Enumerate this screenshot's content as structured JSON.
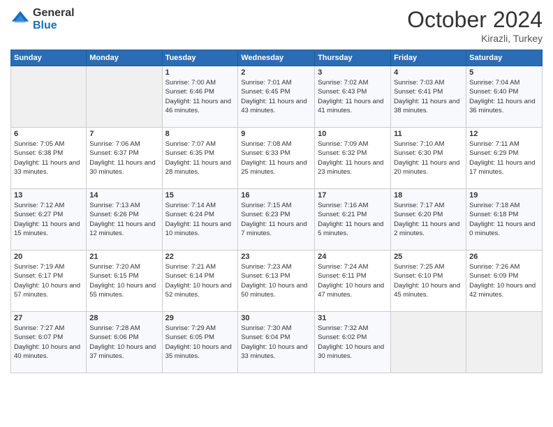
{
  "logo": {
    "general": "General",
    "blue": "Blue"
  },
  "header": {
    "month": "October 2024",
    "location": "Kirazli, Turkey"
  },
  "days_of_week": [
    "Sunday",
    "Monday",
    "Tuesday",
    "Wednesday",
    "Thursday",
    "Friday",
    "Saturday"
  ],
  "weeks": [
    [
      {
        "day": "",
        "sunrise": "",
        "sunset": "",
        "daylight": ""
      },
      {
        "day": "",
        "sunrise": "",
        "sunset": "",
        "daylight": ""
      },
      {
        "day": "1",
        "sunrise": "Sunrise: 7:00 AM",
        "sunset": "Sunset: 6:46 PM",
        "daylight": "Daylight: 11 hours and 46 minutes."
      },
      {
        "day": "2",
        "sunrise": "Sunrise: 7:01 AM",
        "sunset": "Sunset: 6:45 PM",
        "daylight": "Daylight: 11 hours and 43 minutes."
      },
      {
        "day": "3",
        "sunrise": "Sunrise: 7:02 AM",
        "sunset": "Sunset: 6:43 PM",
        "daylight": "Daylight: 11 hours and 41 minutes."
      },
      {
        "day": "4",
        "sunrise": "Sunrise: 7:03 AM",
        "sunset": "Sunset: 6:41 PM",
        "daylight": "Daylight: 11 hours and 38 minutes."
      },
      {
        "day": "5",
        "sunrise": "Sunrise: 7:04 AM",
        "sunset": "Sunset: 6:40 PM",
        "daylight": "Daylight: 11 hours and 36 minutes."
      }
    ],
    [
      {
        "day": "6",
        "sunrise": "Sunrise: 7:05 AM",
        "sunset": "Sunset: 6:38 PM",
        "daylight": "Daylight: 11 hours and 33 minutes."
      },
      {
        "day": "7",
        "sunrise": "Sunrise: 7:06 AM",
        "sunset": "Sunset: 6:37 PM",
        "daylight": "Daylight: 11 hours and 30 minutes."
      },
      {
        "day": "8",
        "sunrise": "Sunrise: 7:07 AM",
        "sunset": "Sunset: 6:35 PM",
        "daylight": "Daylight: 11 hours and 28 minutes."
      },
      {
        "day": "9",
        "sunrise": "Sunrise: 7:08 AM",
        "sunset": "Sunset: 6:33 PM",
        "daylight": "Daylight: 11 hours and 25 minutes."
      },
      {
        "day": "10",
        "sunrise": "Sunrise: 7:09 AM",
        "sunset": "Sunset: 6:32 PM",
        "daylight": "Daylight: 11 hours and 23 minutes."
      },
      {
        "day": "11",
        "sunrise": "Sunrise: 7:10 AM",
        "sunset": "Sunset: 6:30 PM",
        "daylight": "Daylight: 11 hours and 20 minutes."
      },
      {
        "day": "12",
        "sunrise": "Sunrise: 7:11 AM",
        "sunset": "Sunset: 6:29 PM",
        "daylight": "Daylight: 11 hours and 17 minutes."
      }
    ],
    [
      {
        "day": "13",
        "sunrise": "Sunrise: 7:12 AM",
        "sunset": "Sunset: 6:27 PM",
        "daylight": "Daylight: 11 hours and 15 minutes."
      },
      {
        "day": "14",
        "sunrise": "Sunrise: 7:13 AM",
        "sunset": "Sunset: 6:26 PM",
        "daylight": "Daylight: 11 hours and 12 minutes."
      },
      {
        "day": "15",
        "sunrise": "Sunrise: 7:14 AM",
        "sunset": "Sunset: 6:24 PM",
        "daylight": "Daylight: 11 hours and 10 minutes."
      },
      {
        "day": "16",
        "sunrise": "Sunrise: 7:15 AM",
        "sunset": "Sunset: 6:23 PM",
        "daylight": "Daylight: 11 hours and 7 minutes."
      },
      {
        "day": "17",
        "sunrise": "Sunrise: 7:16 AM",
        "sunset": "Sunset: 6:21 PM",
        "daylight": "Daylight: 11 hours and 5 minutes."
      },
      {
        "day": "18",
        "sunrise": "Sunrise: 7:17 AM",
        "sunset": "Sunset: 6:20 PM",
        "daylight": "Daylight: 11 hours and 2 minutes."
      },
      {
        "day": "19",
        "sunrise": "Sunrise: 7:18 AM",
        "sunset": "Sunset: 6:18 PM",
        "daylight": "Daylight: 11 hours and 0 minutes."
      }
    ],
    [
      {
        "day": "20",
        "sunrise": "Sunrise: 7:19 AM",
        "sunset": "Sunset: 6:17 PM",
        "daylight": "Daylight: 10 hours and 57 minutes."
      },
      {
        "day": "21",
        "sunrise": "Sunrise: 7:20 AM",
        "sunset": "Sunset: 6:15 PM",
        "daylight": "Daylight: 10 hours and 55 minutes."
      },
      {
        "day": "22",
        "sunrise": "Sunrise: 7:21 AM",
        "sunset": "Sunset: 6:14 PM",
        "daylight": "Daylight: 10 hours and 52 minutes."
      },
      {
        "day": "23",
        "sunrise": "Sunrise: 7:23 AM",
        "sunset": "Sunset: 6:13 PM",
        "daylight": "Daylight: 10 hours and 50 minutes."
      },
      {
        "day": "24",
        "sunrise": "Sunrise: 7:24 AM",
        "sunset": "Sunset: 6:11 PM",
        "daylight": "Daylight: 10 hours and 47 minutes."
      },
      {
        "day": "25",
        "sunrise": "Sunrise: 7:25 AM",
        "sunset": "Sunset: 6:10 PM",
        "daylight": "Daylight: 10 hours and 45 minutes."
      },
      {
        "day": "26",
        "sunrise": "Sunrise: 7:26 AM",
        "sunset": "Sunset: 6:09 PM",
        "daylight": "Daylight: 10 hours and 42 minutes."
      }
    ],
    [
      {
        "day": "27",
        "sunrise": "Sunrise: 7:27 AM",
        "sunset": "Sunset: 6:07 PM",
        "daylight": "Daylight: 10 hours and 40 minutes."
      },
      {
        "day": "28",
        "sunrise": "Sunrise: 7:28 AM",
        "sunset": "Sunset: 6:06 PM",
        "daylight": "Daylight: 10 hours and 37 minutes."
      },
      {
        "day": "29",
        "sunrise": "Sunrise: 7:29 AM",
        "sunset": "Sunset: 6:05 PM",
        "daylight": "Daylight: 10 hours and 35 minutes."
      },
      {
        "day": "30",
        "sunrise": "Sunrise: 7:30 AM",
        "sunset": "Sunset: 6:04 PM",
        "daylight": "Daylight: 10 hours and 33 minutes."
      },
      {
        "day": "31",
        "sunrise": "Sunrise: 7:32 AM",
        "sunset": "Sunset: 6:02 PM",
        "daylight": "Daylight: 10 hours and 30 minutes."
      },
      {
        "day": "",
        "sunrise": "",
        "sunset": "",
        "daylight": ""
      },
      {
        "day": "",
        "sunrise": "",
        "sunset": "",
        "daylight": ""
      }
    ]
  ]
}
